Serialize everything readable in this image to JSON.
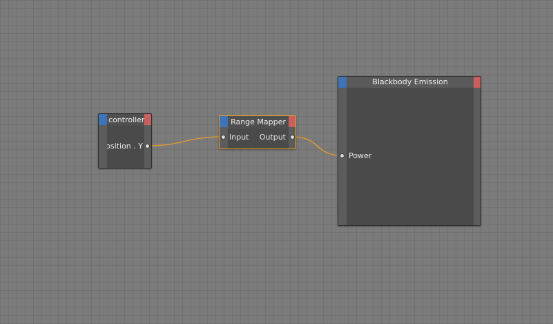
{
  "nodes": {
    "controller": {
      "title": "controller",
      "output_port": "Position . Y"
    },
    "range_mapper": {
      "title": "Range Mapper",
      "input_port": "Input",
      "output_port": "Output"
    },
    "blackbody": {
      "title": "Blackbody Emission",
      "input_port": "Power"
    }
  },
  "colors": {
    "wire": "#f0a020",
    "input_tab": "#3e73b5",
    "output_tab": "#c96060",
    "selection": "#f0a020"
  }
}
